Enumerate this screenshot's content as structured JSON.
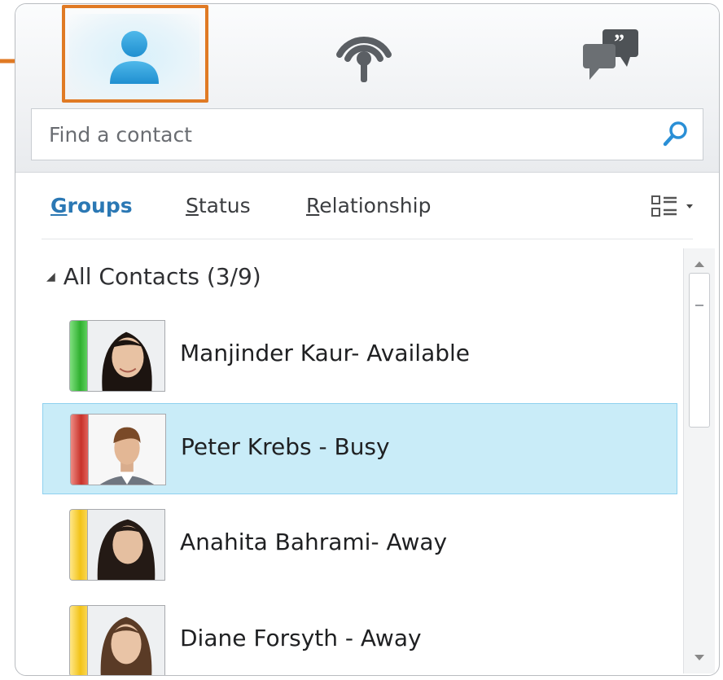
{
  "toolbar": {
    "tabs": [
      {
        "name": "contacts",
        "icon": "person-icon"
      },
      {
        "name": "activity",
        "icon": "wireless-signal-icon"
      },
      {
        "name": "conversations",
        "icon": "chat-bubbles-icon"
      }
    ]
  },
  "search": {
    "placeholder": "Find a contact",
    "icon": "search-icon"
  },
  "view_tabs": {
    "groups": {
      "mnemonic": "G",
      "rest": "roups"
    },
    "status": {
      "mnemonic": "S",
      "rest": "tatus"
    },
    "relationship": {
      "mnemonic": "R",
      "rest": "elationship"
    },
    "layout_icon": "list-layout-icon"
  },
  "contacts_group": {
    "label": "All Contacts (3/9)"
  },
  "contacts": [
    {
      "name": "Manjinder Kaur- Available",
      "presence_color": "#3cbf3c"
    },
    {
      "name": "Peter Krebs - Busy",
      "presence_color": "#d8453c"
    },
    {
      "name": "Anahita Bahrami- Away",
      "presence_color": "#f5c825"
    },
    {
      "name": "Diane Forsyth - Away",
      "presence_color": "#f5c825"
    }
  ],
  "colors": {
    "accent_blue": "#2b78b4",
    "highlight_orange": "#e07a24",
    "selection": "#c9ecf8"
  }
}
